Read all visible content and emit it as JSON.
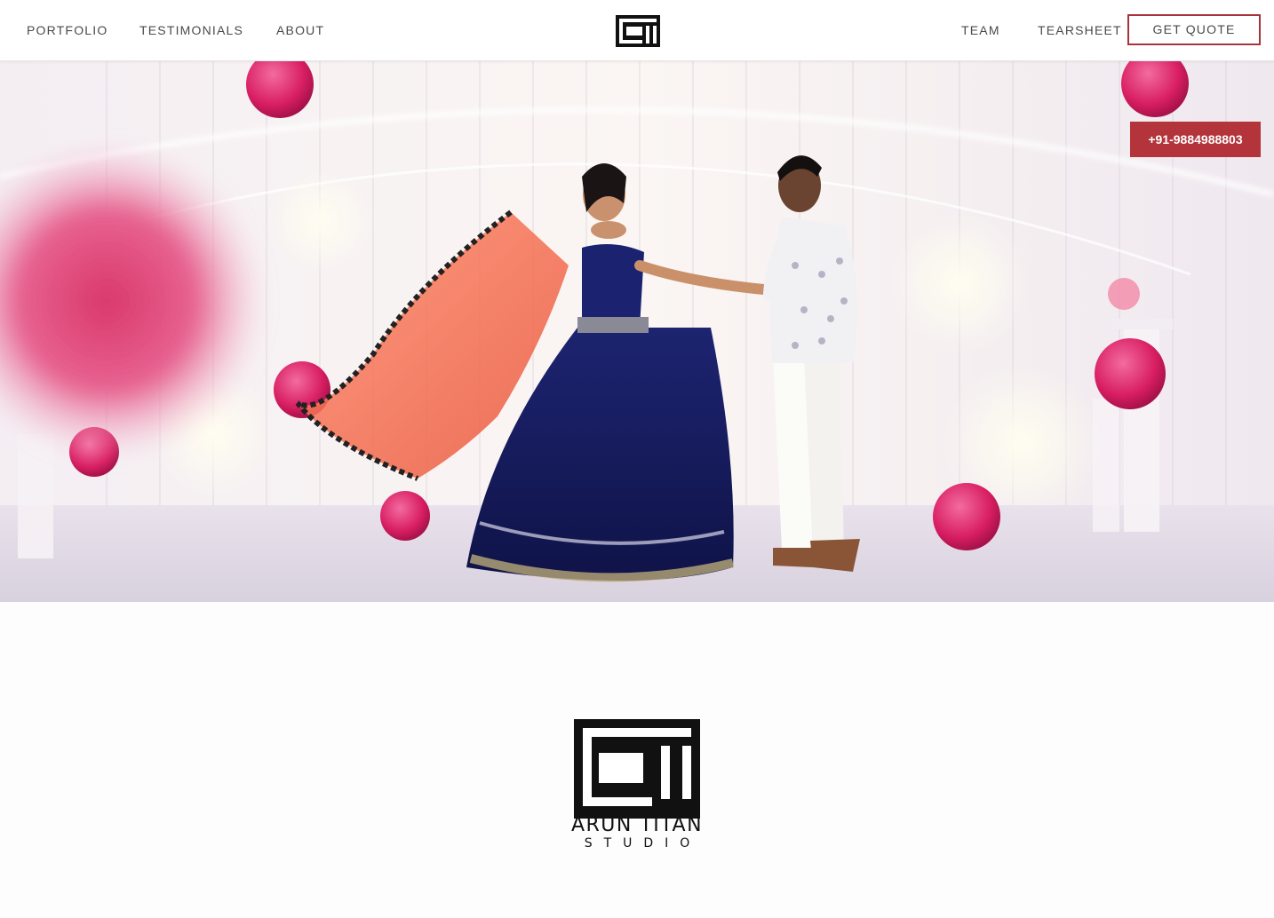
{
  "header": {
    "nav_left": [
      "PORTFOLIO",
      "TESTIMONIALS",
      "ABOUT"
    ],
    "nav_right": [
      "TEAM",
      "TEARSHEET"
    ],
    "quote_button": "GET QUOTE"
  },
  "hero": {
    "phone": "+91-9884988803"
  },
  "brand": {
    "name": "ARUN TITAN",
    "subtitle": "STUDIO"
  },
  "colors": {
    "accent": "#b3343a",
    "nav_text": "#4a4a4a"
  },
  "icons": {
    "logo": "arun-titan-logo-icon"
  }
}
